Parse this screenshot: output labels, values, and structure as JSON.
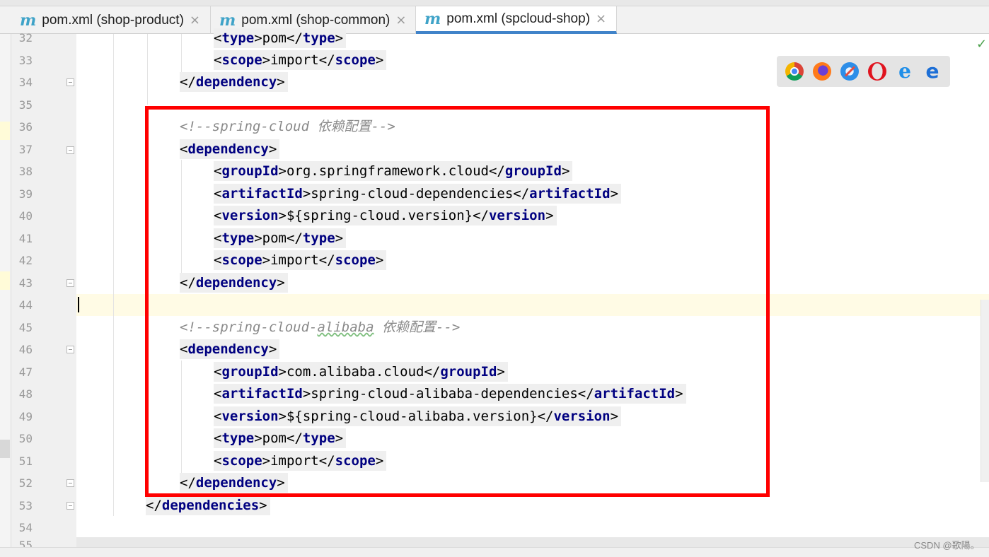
{
  "tabs": [
    {
      "icon": "m",
      "label": "pom.xml (shop-product)",
      "close": "×"
    },
    {
      "icon": "m",
      "label": "pom.xml (shop-common)",
      "close": "×"
    },
    {
      "icon": "m",
      "label": "pom.xml (spcloud-shop)",
      "close": "×",
      "active": true
    }
  ],
  "line_numbers": [
    "32",
    "33",
    "34",
    "35",
    "36",
    "37",
    "38",
    "39",
    "40",
    "41",
    "42",
    "43",
    "44",
    "45",
    "46",
    "47",
    "48",
    "49",
    "50",
    "51",
    "52",
    "53",
    "54",
    "55"
  ],
  "code": {
    "l32": {
      "open": "type",
      "text": "pom",
      "close": "type"
    },
    "l33": {
      "open": "scope",
      "text": "import",
      "close": "scope"
    },
    "l34": {
      "close": "dependency"
    },
    "l36": {
      "comment": "<!--spring-cloud 依赖配置-->"
    },
    "l37": {
      "open": "dependency"
    },
    "l38": {
      "open": "groupId",
      "text": "org.springframework.cloud",
      "close": "groupId"
    },
    "l39": {
      "open": "artifactId",
      "text": "spring-cloud-dependencies",
      "close": "artifactId"
    },
    "l40": {
      "open": "version",
      "text": "${spring-cloud.version}",
      "close": "version"
    },
    "l41": {
      "open": "type",
      "text": "pom",
      "close": "type"
    },
    "l42": {
      "open": "scope",
      "text": "import",
      "close": "scope"
    },
    "l43": {
      "close": "dependency"
    },
    "l45": {
      "comment_a": "<!--spring-cloud-",
      "comment_b": "alibaba",
      "comment_c": " 依赖配置-->"
    },
    "l46": {
      "open": "dependency"
    },
    "l47": {
      "open": "groupId",
      "text": "com.alibaba.cloud",
      "close": "groupId"
    },
    "l48": {
      "open": "artifactId",
      "text": "spring-cloud-alibaba-dependencies",
      "close": "artifactId"
    },
    "l49": {
      "open": "version",
      "text": "${spring-cloud-alibaba.version}",
      "close": "version"
    },
    "l50": {
      "open": "type",
      "text": "pom",
      "close": "type"
    },
    "l51": {
      "open": "scope",
      "text": "import",
      "close": "scope"
    },
    "l52": {
      "close": "dependency"
    },
    "l53": {
      "close": "dependencies"
    }
  },
  "browsers": [
    "chrome-icon",
    "firefox-icon",
    "safari-icon",
    "opera-icon",
    "ie-icon",
    "edge-icon"
  ],
  "ie_glyph": "e",
  "edge_glyph": "e",
  "check_glyph": "✓",
  "watermark": "CSDN @歌陽。",
  "colors": {
    "tag": "#000080",
    "comment": "#8a8a8a",
    "highlight_box": "#ff0000",
    "tab_underline": "#4083c9"
  }
}
